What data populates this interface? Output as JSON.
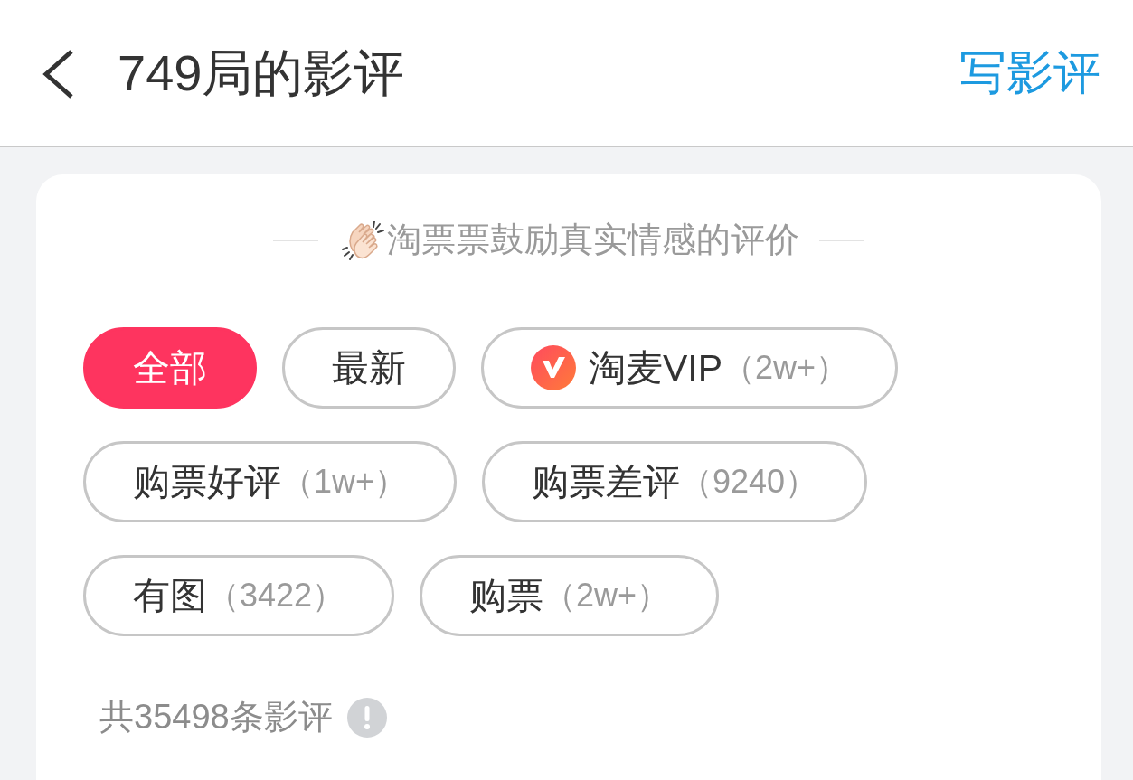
{
  "header": {
    "title": "749局的影评",
    "action": "写影评"
  },
  "banner": {
    "text": "淘票票鼓励真实情感的评价"
  },
  "filters": [
    {
      "kind": "plain",
      "label": "全部",
      "selected": true
    },
    {
      "kind": "plain",
      "label": "最新",
      "selected": false
    },
    {
      "kind": "logo",
      "label": "淘麦VIP",
      "count": "（2w+）",
      "selected": false
    },
    {
      "kind": "plain",
      "label": "购票好评",
      "count": "（1w+）",
      "selected": false
    },
    {
      "kind": "plain",
      "label": "购票差评",
      "count": "（9240）",
      "selected": false
    },
    {
      "kind": "plain",
      "label": "有图",
      "count": "（3422）",
      "selected": false
    },
    {
      "kind": "plain",
      "label": "购票",
      "count": "（2w+）",
      "selected": false
    }
  ],
  "summary": {
    "total": "共35498条影评"
  }
}
